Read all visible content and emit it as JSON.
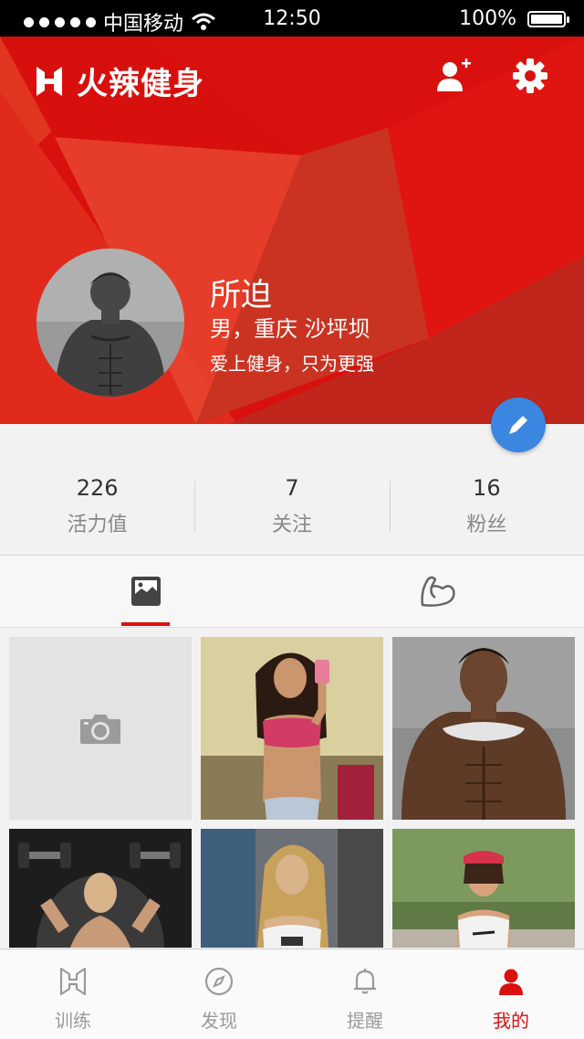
{
  "status_bar": {
    "carrier": "中国移动",
    "time": "12:50",
    "battery": "100%"
  },
  "header": {
    "app_name": "火辣健身"
  },
  "profile": {
    "name": "所迫",
    "info": "男，重庆 沙坪坝",
    "motto": "爱上健身，只为更强"
  },
  "stats": [
    {
      "value": "226",
      "label": "活力值"
    },
    {
      "value": "7",
      "label": "关注"
    },
    {
      "value": "16",
      "label": "粉丝"
    }
  ],
  "tabbar": [
    {
      "label": "训练",
      "icon": "logo-h-icon"
    },
    {
      "label": "发现",
      "icon": "compass-icon"
    },
    {
      "label": "提醒",
      "icon": "bell-icon"
    },
    {
      "label": "我的",
      "icon": "person-icon"
    }
  ],
  "colors": {
    "brand_red": "#d9110e",
    "edit_blue": "#3a86e0"
  }
}
